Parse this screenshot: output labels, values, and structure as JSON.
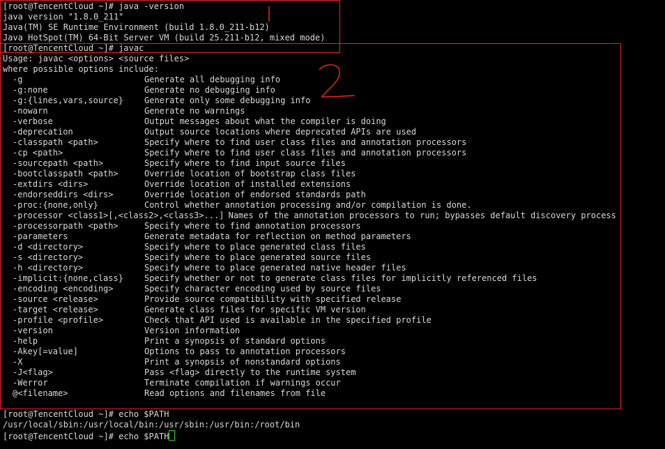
{
  "terminal": {
    "header_lines": [
      "[root@TencentCloud ~]# java -version",
      "java version \"1.8.0_211\"",
      "Java(TM) SE Runtime Environment (build 1.8.0_211-b12)",
      "Java HotSpot(TM) 64-Bit Server VM (build 25.211-b12, mixed mode)",
      "[root@TencentCloud ~]# javac",
      "Usage: javac <options> <source files>",
      "where possible options include:"
    ],
    "options": [
      {
        "flag": "-g",
        "desc": "Generate all debugging info"
      },
      {
        "flag": "-g:none",
        "desc": "Generate no debugging info"
      },
      {
        "flag": "-g:{lines,vars,source}",
        "desc": "Generate only some debugging info"
      },
      {
        "flag": "-nowarn",
        "desc": "Generate no warnings"
      },
      {
        "flag": "-verbose",
        "desc": "Output messages about what the compiler is doing"
      },
      {
        "flag": "-deprecation",
        "desc": "Output source locations where deprecated APIs are used"
      },
      {
        "flag": "-classpath <path>",
        "desc": "Specify where to find user class files and annotation processors"
      },
      {
        "flag": "-cp <path>",
        "desc": "Specify where to find user class files and annotation processors"
      },
      {
        "flag": "-sourcepath <path>",
        "desc": "Specify where to find input source files"
      },
      {
        "flag": "-bootclasspath <path>",
        "desc": "Override location of bootstrap class files"
      },
      {
        "flag": "-extdirs <dirs>",
        "desc": "Override location of installed extensions"
      },
      {
        "flag": "-endorseddirs <dirs>",
        "desc": "Override location of endorsed standards path"
      },
      {
        "flag": "-proc:{none,only}",
        "desc": "Control whether annotation processing and/or compilation is done."
      },
      {
        "flag": "-processor <class1>[,<class2>,<class3>...]",
        "desc": "Names of the annotation processors to run; bypasses default discovery process"
      },
      {
        "flag": "-processorpath <path>",
        "desc": "Specify where to find annotation processors"
      },
      {
        "flag": "-parameters",
        "desc": "Generate metadata for reflection on method parameters"
      },
      {
        "flag": "-d <directory>",
        "desc": "Specify where to place generated class files"
      },
      {
        "flag": "-s <directory>",
        "desc": "Specify where to place generated source files"
      },
      {
        "flag": "-h <directory>",
        "desc": "Specify where to place generated native header files"
      },
      {
        "flag": "-implicit:{none,class}",
        "desc": "Specify whether or not to generate class files for implicitly referenced files"
      },
      {
        "flag": "-encoding <encoding>",
        "desc": "Specify character encoding used by source files"
      },
      {
        "flag": "-source <release>",
        "desc": "Provide source compatibility with specified release"
      },
      {
        "flag": "-target <release>",
        "desc": "Generate class files for specific VM version"
      },
      {
        "flag": "-profile <profile>",
        "desc": "Check that API used is available in the specified profile"
      },
      {
        "flag": "-version",
        "desc": "Version information"
      },
      {
        "flag": "-help",
        "desc": "Print a synopsis of standard options"
      },
      {
        "flag": "-Akey[=value]",
        "desc": "Options to pass to annotation processors"
      },
      {
        "flag": "-X",
        "desc": "Print a synopsis of nonstandard options"
      },
      {
        "flag": "-J<flag>",
        "desc": "Pass <flag> directly to the runtime system"
      },
      {
        "flag": "-Werror",
        "desc": "Terminate compilation if warnings occur"
      },
      {
        "flag": "@<filename>",
        "desc": "Read options and filenames from file"
      }
    ],
    "footer_lines": [
      "[root@TencentCloud ~]# echo $PATH",
      "/usr/local/sbin:/usr/local/bin:/usr/sbin:/usr/bin:/root/bin"
    ],
    "prompt_line": "[root@TencentCloud ~]# echo $PATH"
  },
  "colors": {
    "background": "#000000",
    "text": "#d9d9d9",
    "annotation_red": "#e8262c",
    "cursor_green": "#27d627"
  }
}
